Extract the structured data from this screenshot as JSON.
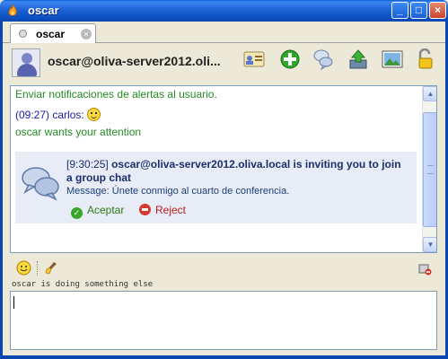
{
  "window": {
    "title": "oscar",
    "controls": {
      "minimize": "_",
      "maximize": "□",
      "close": "×"
    }
  },
  "tab": {
    "label": "oscar",
    "close_glyph": "×"
  },
  "header": {
    "contact": "oscar@oliva-server2012.oli...",
    "icons": [
      "vcard-icon",
      "add-contact-icon",
      "invite-chat-icon",
      "file-transfer-icon",
      "screenshot-icon",
      "unlocked-icon"
    ]
  },
  "transcript": {
    "lines": [
      {
        "text": "Enviar notificaciones de alertas al usuario.",
        "color": "green"
      },
      {
        "time": "(09:27)",
        "sender": "carlos:",
        "emoticon": "smile-icon"
      },
      {
        "text": "oscar wants your attention",
        "color": "green"
      }
    ],
    "invite": {
      "timestamp": "[9:30:25]",
      "title": "oscar@oliva-server2012.oliva.local is inviting you to join a group chat",
      "message_label": "Message:",
      "message": "Únete conmigo al cuarto de conferencia.",
      "accept_label": "Aceptar",
      "reject_label": "Reject"
    }
  },
  "composer": {
    "status_text": "oscar is doing something else",
    "value": ""
  },
  "colors": {
    "titlebar": "#1d64d6",
    "green_text": "#228b22",
    "blue_text": "#1a1aa6",
    "invite_bg": "#e7ecf6"
  }
}
